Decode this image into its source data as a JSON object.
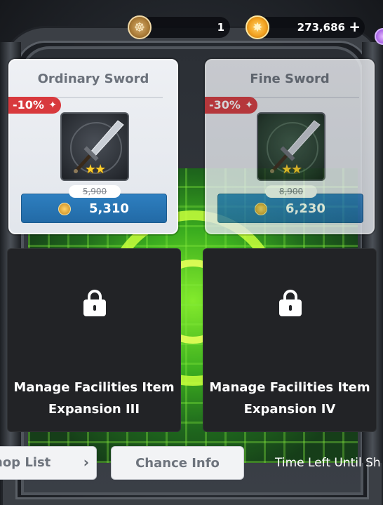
{
  "currency": {
    "token_count": "1",
    "gold_amount": "273,686",
    "plus_symbol": "+"
  },
  "items": [
    {
      "name": "Ordinary Sword",
      "discount": "-10%",
      "stars": "★★",
      "original_price": "5,900",
      "price": "5,310",
      "rarity": "common"
    },
    {
      "name": "Fine Sword",
      "discount": "-30%",
      "stars": "★★",
      "original_price": "8,900",
      "price": "6,230",
      "rarity": "uncommon"
    }
  ],
  "locked_slots": [
    {
      "title": "Manage Facilities Item Expansion III"
    },
    {
      "title": "Manage Facilities Item Expansion IV"
    }
  ],
  "bottom": {
    "shop_list_label": "hop List",
    "chance_info_label": "Chance Info",
    "time_left_label": "Time Left Until Sh"
  },
  "colors": {
    "discount_red": "#d8393d",
    "buy_blue": "#2e7fc0",
    "glow_green": "#8dff2a"
  }
}
